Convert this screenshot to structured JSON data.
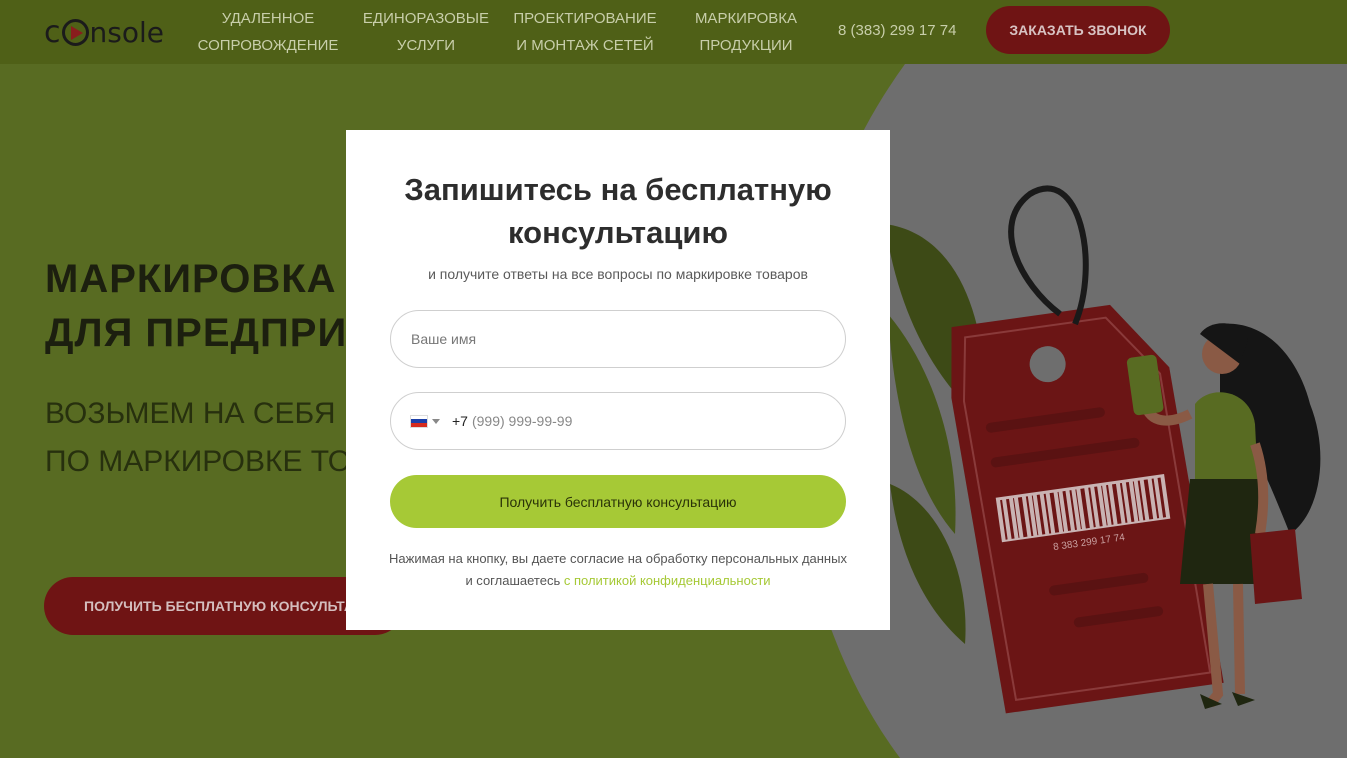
{
  "header": {
    "logo_text": "console",
    "nav": [
      {
        "line1": "УДАЛЕННОЕ",
        "line2": "СОПРОВОЖДЕНИЕ"
      },
      {
        "line1": "ЕДИНОРАЗОВЫЕ",
        "line2": "УСЛУГИ"
      },
      {
        "line1": "ПРОЕКТИРОВАНИЕ",
        "line2": "И МОНТАЖ СЕТЕЙ"
      },
      {
        "line1": "МАРКИРОВКА",
        "line2": "ПРОДУКЦИИ"
      }
    ],
    "phone": "8 (383) 299 17 74",
    "call_button": "ЗАКАЗАТЬ ЗВОНОК"
  },
  "hero": {
    "title": "МАРКИРОВКА П\nДЛЯ ПРЕДПРИН",
    "subtitle": "ВОЗЬМЕМ НА СЕБЯ ВСЕ\nПО МАРКИРОВКЕ ТОВАІ",
    "button": "ПОЛУЧИТЬ БЕСПЛАТНУЮ КОНСУЛЬТАЦИ",
    "tag_phone": "8 383 299 17 74"
  },
  "modal": {
    "title": "Запишитесь на бесплатную\nконсультацию",
    "subtitle": "и получите ответы на все вопросы по маркировке товаров",
    "name_placeholder": "Ваше имя",
    "phone_code": "+7",
    "phone_placeholder": "(999) 999-99-99",
    "submit": "Получить бесплатную консультацию",
    "consent_text": "Нажимая на кнопку, вы даете согласие на обработку персональных данных",
    "consent_text2": "и соглашаетесь ",
    "consent_link": "с политикой конфиденциальности"
  },
  "colors": {
    "header_bg": "#4f6017",
    "hero_green": "#586b22",
    "accent_red": "#6f1414",
    "submit_green": "#a6c936"
  }
}
